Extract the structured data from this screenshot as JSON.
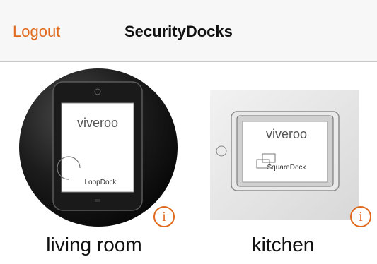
{
  "nav": {
    "logout_label": "Logout",
    "title": "SecurityDocks"
  },
  "docks": [
    {
      "name": "living room",
      "brand": "viveroo",
      "model": "LoopDock",
      "info_glyph": "i"
    },
    {
      "name": "kitchen",
      "brand": "viveroo",
      "model": "SquareDock",
      "info_glyph": "i"
    }
  ],
  "colors": {
    "accent": "#e0691e",
    "nav_bg": "#f7f7f7",
    "text": "#111111"
  }
}
